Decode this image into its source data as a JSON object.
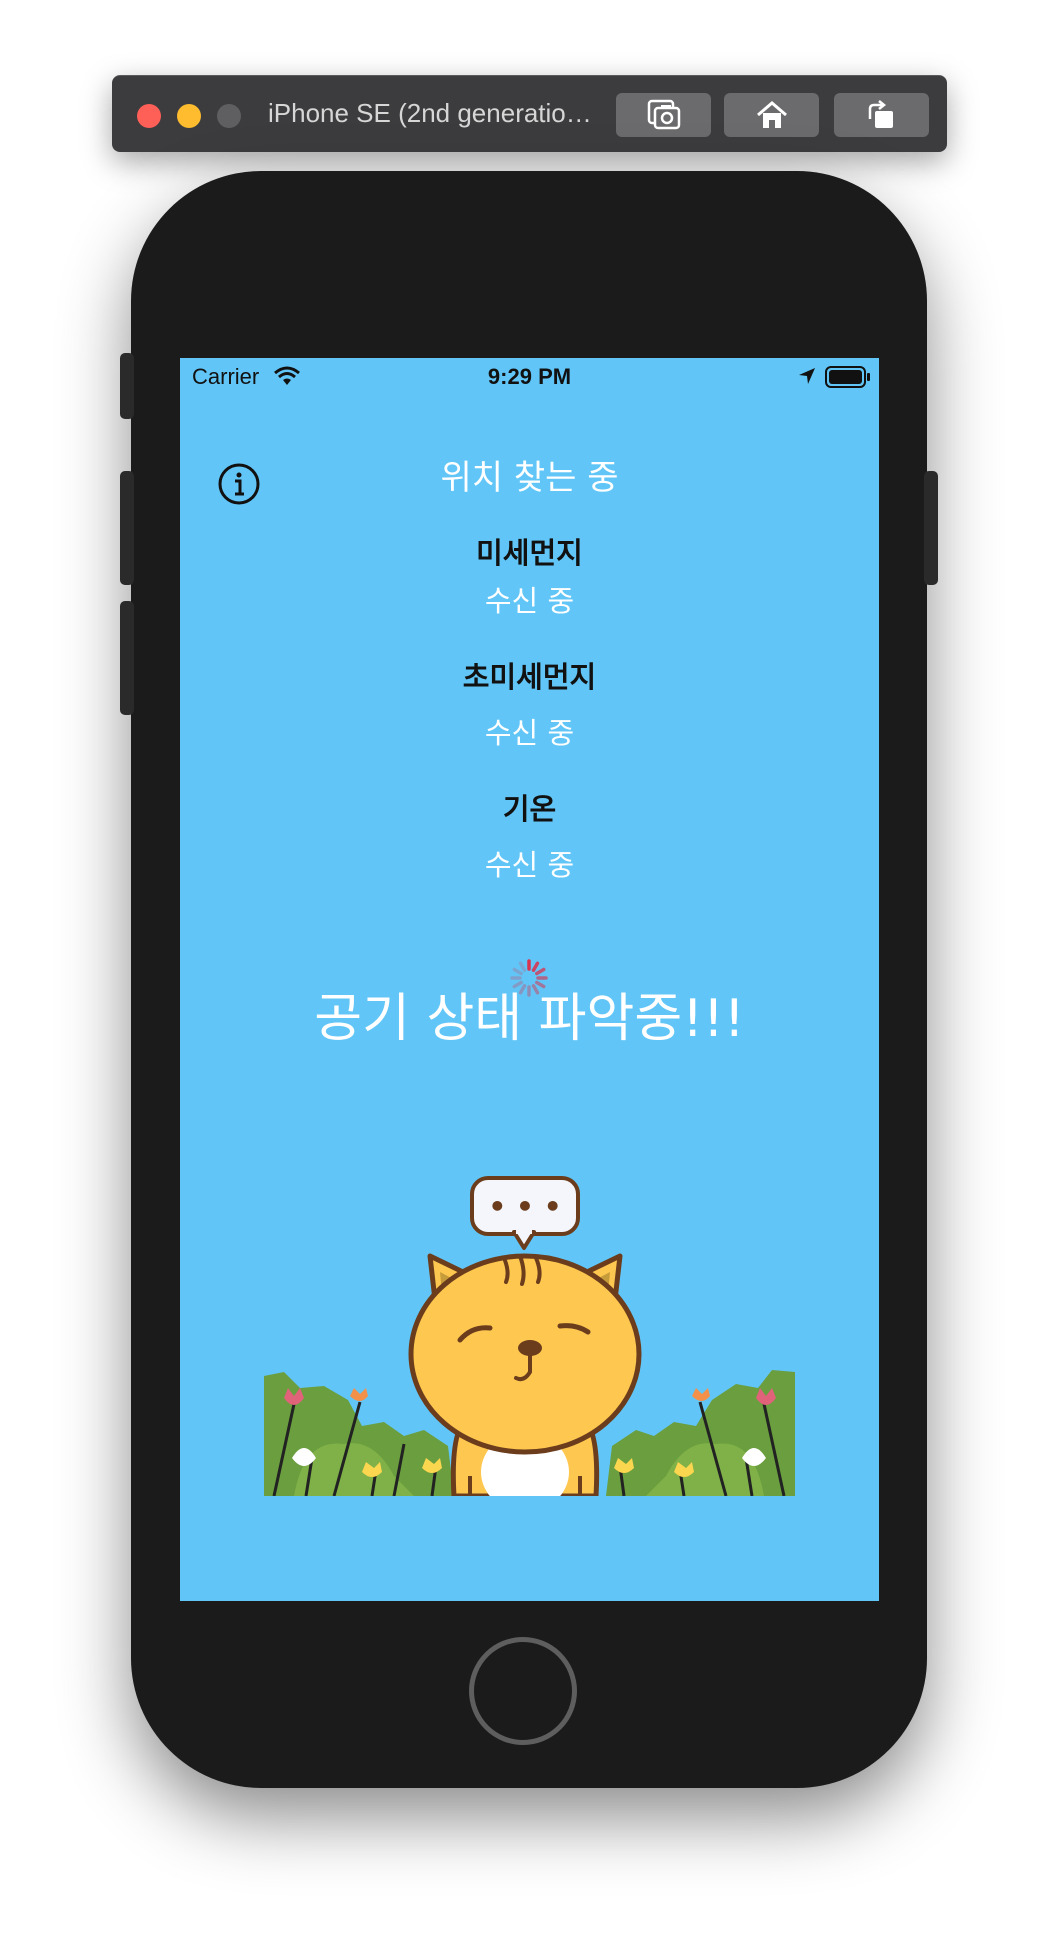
{
  "simulator": {
    "title": "iPhone SE (2nd generatio…",
    "buttons": [
      "screenshot-icon",
      "home-icon",
      "rotate-icon"
    ]
  },
  "status_bar": {
    "carrier": "Carrier",
    "time": "9:29 PM"
  },
  "app": {
    "location": "위치 찾는 중",
    "metrics": [
      {
        "label": "미세먼지",
        "value": "수신 중"
      },
      {
        "label": "초미세먼지",
        "value": "수신 중"
      },
      {
        "label": "기온",
        "value": "수신 중"
      }
    ],
    "main_status": "공기 상태 파악중!!!",
    "bubble_text": "• • •"
  },
  "colors": {
    "screen_bg": "#61c6f7",
    "cat_body": "#fec74f",
    "cat_outline": "#6b3d1c",
    "grass": "#6a9e3e"
  }
}
